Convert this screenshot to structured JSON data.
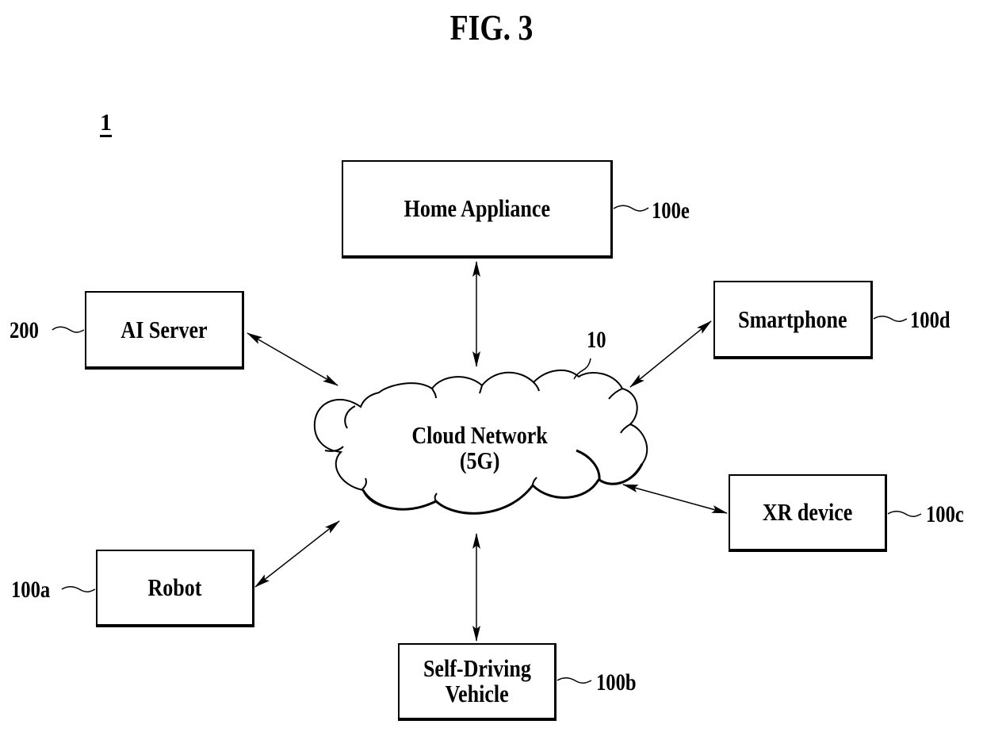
{
  "figure": {
    "title": "FIG. 3",
    "system_ref": "1"
  },
  "network": {
    "label_line1": "Cloud Network",
    "label_line2": "(5G)",
    "ref": "10"
  },
  "nodes": [
    {
      "id": "home-appliance",
      "label": "Home Appliance",
      "ref": "100e"
    },
    {
      "id": "ai-server",
      "label": "AI Server",
      "ref": "200"
    },
    {
      "id": "smartphone",
      "label": "Smartphone",
      "ref": "100d"
    },
    {
      "id": "xr-device",
      "label": "XR device",
      "ref": "100c"
    },
    {
      "id": "robot",
      "label": "Robot",
      "ref": "100a"
    },
    {
      "id": "self-driving-vehicle",
      "label_line1": "Self-Driving",
      "label_line2": "Vehicle",
      "ref": "100b"
    }
  ],
  "connections": [
    {
      "from": "cloud-network",
      "to": "home-appliance",
      "type": "bidirectional"
    },
    {
      "from": "cloud-network",
      "to": "ai-server",
      "type": "bidirectional"
    },
    {
      "from": "cloud-network",
      "to": "smartphone",
      "type": "bidirectional"
    },
    {
      "from": "cloud-network",
      "to": "xr-device",
      "type": "bidirectional"
    },
    {
      "from": "cloud-network",
      "to": "robot",
      "type": "bidirectional"
    },
    {
      "from": "cloud-network",
      "to": "self-driving-vehicle",
      "type": "bidirectional"
    }
  ]
}
